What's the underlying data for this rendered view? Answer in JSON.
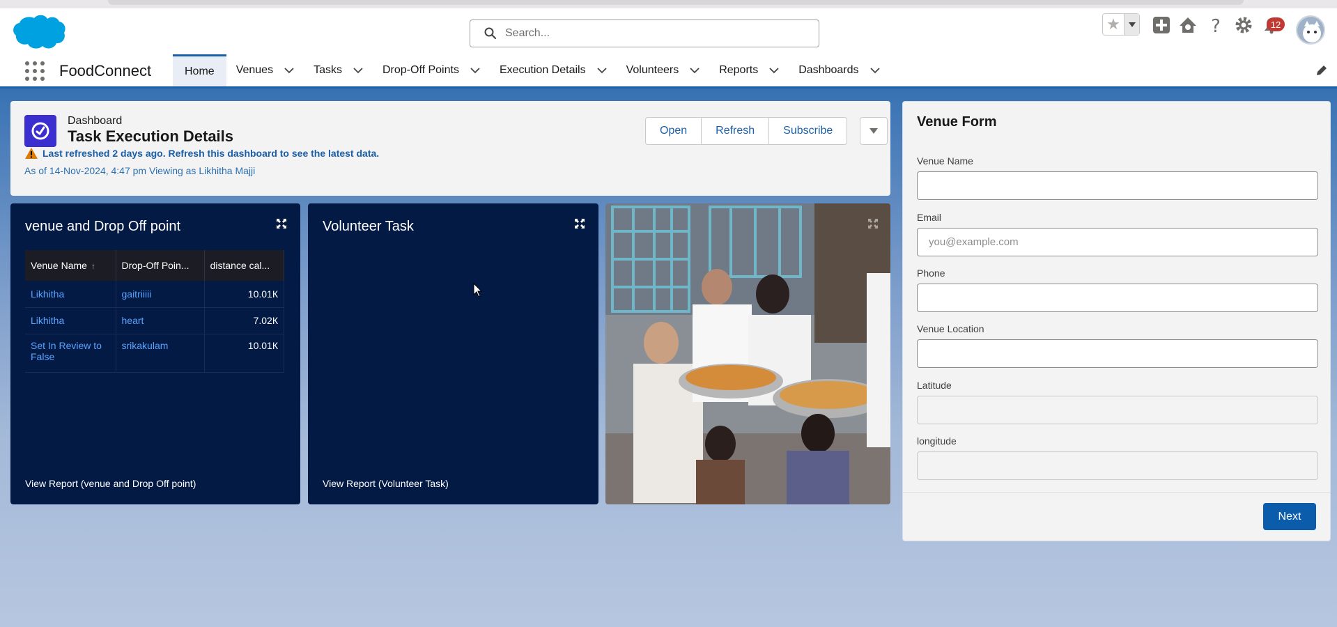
{
  "header": {
    "search_placeholder": "Search...",
    "notification_count": "12"
  },
  "nav": {
    "app_name": "FoodConnect",
    "items": [
      {
        "label": "Home",
        "active": true,
        "chevron": false
      },
      {
        "label": "Venues",
        "active": false,
        "chevron": true
      },
      {
        "label": "Tasks",
        "active": false,
        "chevron": true
      },
      {
        "label": "Drop-Off Points",
        "active": false,
        "chevron": true
      },
      {
        "label": "Execution Details",
        "active": false,
        "chevron": true
      },
      {
        "label": "Volunteers",
        "active": false,
        "chevron": true
      },
      {
        "label": "Reports",
        "active": false,
        "chevron": true
      },
      {
        "label": "Dashboards",
        "active": false,
        "chevron": true
      }
    ]
  },
  "dashboard": {
    "label": "Dashboard",
    "title": "Task Execution Details",
    "warning": "Last refreshed 2 days ago. Refresh this dashboard to see the latest data.",
    "as_of": "As of 14-Nov-2024, 4:47 pm Viewing as Likhitha Majji",
    "buttons": {
      "open": "Open",
      "refresh": "Refresh",
      "subscribe": "Subscribe"
    }
  },
  "widgets": {
    "venue_dropoff": {
      "title": "venue and Drop Off point",
      "columns": [
        "Venue Name",
        "Drop-Off Poin...",
        "distance cal..."
      ],
      "rows": [
        {
          "venue": "Likhitha",
          "dropoff": "gaitriiiii",
          "distance": "10.01К"
        },
        {
          "venue": "Likhitha",
          "dropoff": "heart",
          "distance": "7.02К"
        },
        {
          "venue": "Set In Review to False",
          "dropoff": "srikakulam",
          "distance": "10.01К"
        }
      ],
      "footer": "View Report (venue and Drop Off point)"
    },
    "volunteer_task": {
      "title": "Volunteer Task",
      "footer": "View Report (Volunteer Task)"
    }
  },
  "venue_form": {
    "title": "Venue Form",
    "fields": {
      "venue_name": {
        "label": "Venue Name",
        "placeholder": ""
      },
      "email": {
        "label": "Email",
        "placeholder": "you@example.com"
      },
      "phone": {
        "label": "Phone",
        "placeholder": ""
      },
      "venue_location": {
        "label": "Venue Location",
        "placeholder": ""
      },
      "latitude": {
        "label": "Latitude",
        "placeholder": ""
      },
      "longitude": {
        "label": "longitude",
        "placeholder": ""
      }
    },
    "next_label": "Next"
  },
  "colors": {
    "brand": "#1b5fa8",
    "widget_bg": "#031a45",
    "primary_button": "#0b5cab",
    "dashboard_icon": "#3c2fd0"
  },
  "icons": [
    "salesforce-cloud-icon",
    "search-icon",
    "star-icon",
    "add-icon",
    "trailhead-icon",
    "help-icon",
    "gear-icon",
    "bell-icon",
    "app-launcher-icon",
    "chevron-down-icon",
    "pencil-icon",
    "dashboard-gauge-icon",
    "warning-icon",
    "expand-icon"
  ]
}
